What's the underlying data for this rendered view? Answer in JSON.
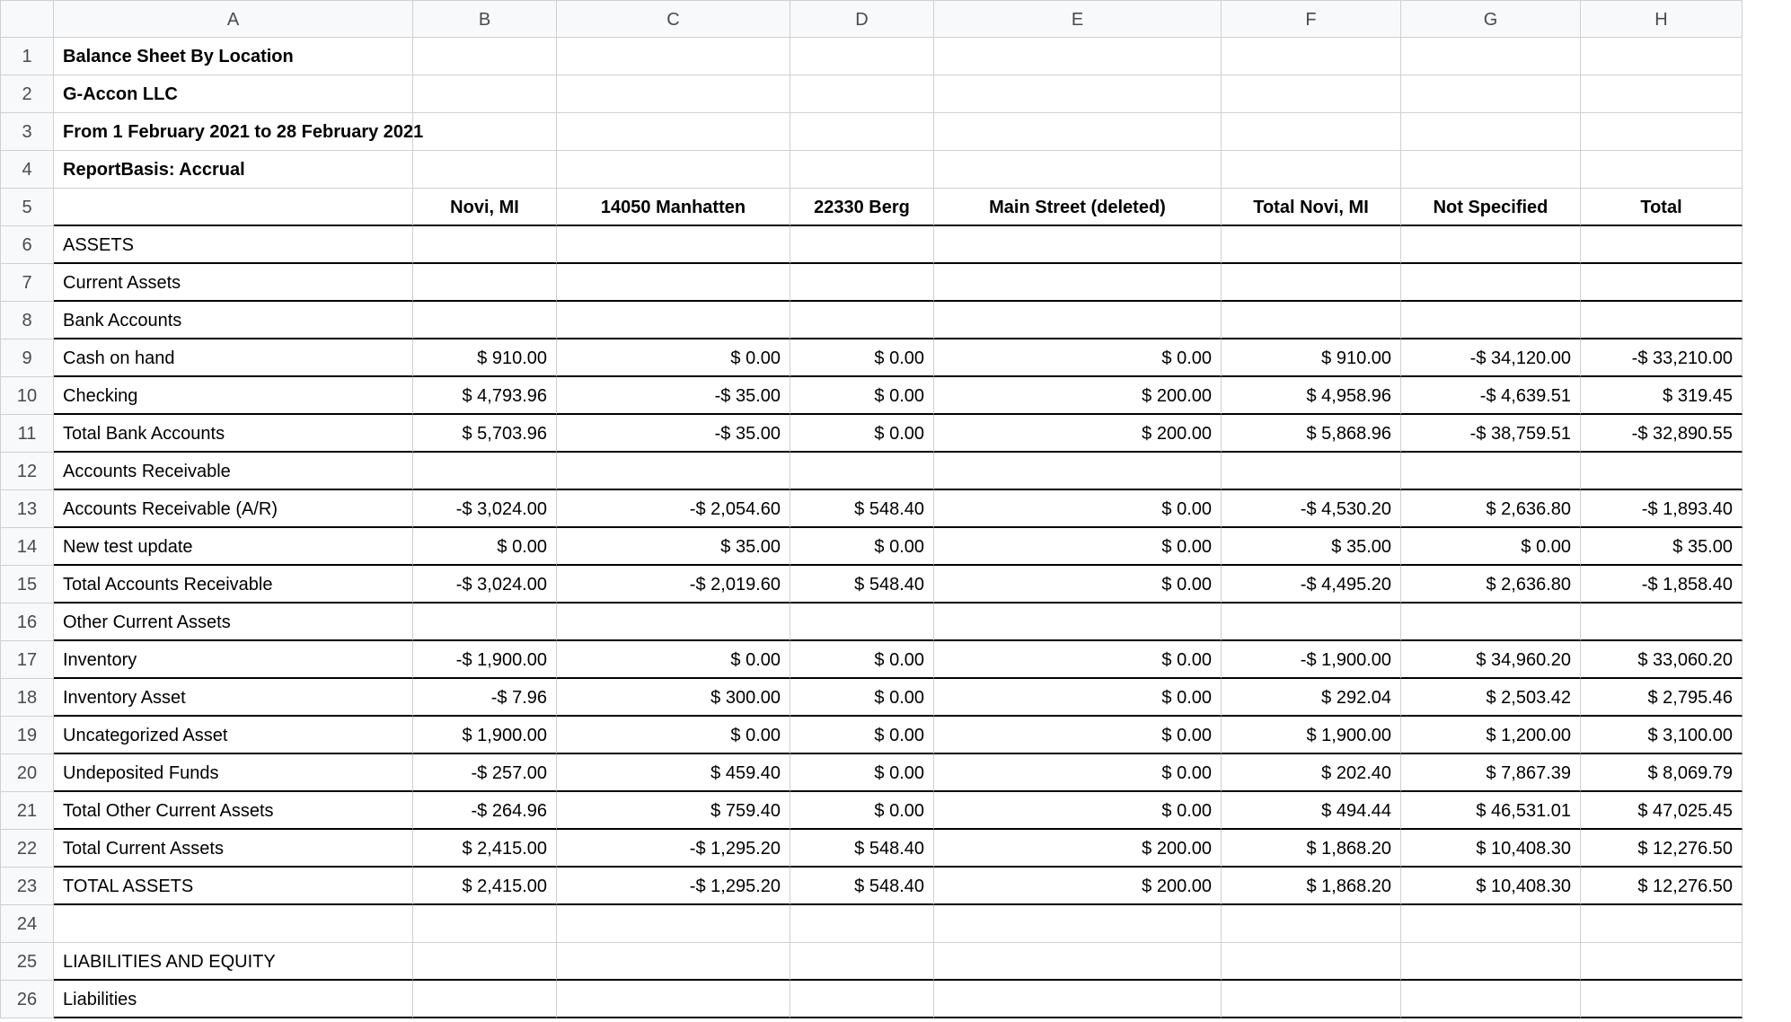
{
  "columns": [
    "A",
    "B",
    "C",
    "D",
    "E",
    "F",
    "G",
    "H"
  ],
  "header": {
    "title": "Balance Sheet By Location",
    "company": "G-Accon LLC",
    "period": "From 1 February 2021 to 28 February 2021",
    "basis": "ReportBasis: Accrual"
  },
  "locHeaders": [
    "Novi, MI",
    "14050 Manhatten",
    "22330 Berg",
    "Main Street (deleted)",
    "Total Novi, MI",
    "Not Specified",
    "Total"
  ],
  "rows": [
    {
      "n": 1,
      "type": "title",
      "a": "title"
    },
    {
      "n": 2,
      "type": "title",
      "a": "company"
    },
    {
      "n": 3,
      "type": "title",
      "a": "period"
    },
    {
      "n": 4,
      "type": "title",
      "a": "basis"
    },
    {
      "n": 5,
      "type": "colhead"
    },
    {
      "n": 6,
      "type": "section",
      "label": "ASSETS"
    },
    {
      "n": 7,
      "type": "section",
      "label": "Current Assets"
    },
    {
      "n": 8,
      "type": "section",
      "label": "Bank Accounts"
    },
    {
      "n": 9,
      "type": "data",
      "label": "Cash on hand",
      "vals": [
        "$ 910.00",
        "$ 0.00",
        "$ 0.00",
        "$ 0.00",
        "$ 910.00",
        "-$ 34,120.00",
        "-$ 33,210.00"
      ]
    },
    {
      "n": 10,
      "type": "data",
      "label": "Checking",
      "vals": [
        "$ 4,793.96",
        "-$ 35.00",
        "$ 0.00",
        "$ 200.00",
        "$ 4,958.96",
        "-$ 4,639.51",
        "$ 319.45"
      ]
    },
    {
      "n": 11,
      "type": "data",
      "label": "Total Bank Accounts",
      "vals": [
        "$ 5,703.96",
        "-$ 35.00",
        "$ 0.00",
        "$ 200.00",
        "$ 5,868.96",
        "-$ 38,759.51",
        "-$ 32,890.55"
      ]
    },
    {
      "n": 12,
      "type": "section",
      "label": "Accounts Receivable"
    },
    {
      "n": 13,
      "type": "data",
      "label": "Accounts Receivable (A/R)",
      "vals": [
        "-$ 3,024.00",
        "-$ 2,054.60",
        "$ 548.40",
        "$ 0.00",
        "-$ 4,530.20",
        "$ 2,636.80",
        "-$ 1,893.40"
      ]
    },
    {
      "n": 14,
      "type": "data",
      "label": "New test update",
      "vals": [
        "$ 0.00",
        "$ 35.00",
        "$ 0.00",
        "$ 0.00",
        "$ 35.00",
        "$ 0.00",
        "$ 35.00"
      ]
    },
    {
      "n": 15,
      "type": "data",
      "label": "Total Accounts Receivable",
      "vals": [
        "-$ 3,024.00",
        "-$ 2,019.60",
        "$ 548.40",
        "$ 0.00",
        "-$ 4,495.20",
        "$ 2,636.80",
        "-$ 1,858.40"
      ]
    },
    {
      "n": 16,
      "type": "section",
      "label": "Other Current Assets"
    },
    {
      "n": 17,
      "type": "data",
      "label": "Inventory",
      "vals": [
        "-$ 1,900.00",
        "$ 0.00",
        "$ 0.00",
        "$ 0.00",
        "-$ 1,900.00",
        "$ 34,960.20",
        "$ 33,060.20"
      ]
    },
    {
      "n": 18,
      "type": "data",
      "label": "Inventory Asset",
      "vals": [
        "-$ 7.96",
        "$ 300.00",
        "$ 0.00",
        "$ 0.00",
        "$ 292.04",
        "$ 2,503.42",
        "$ 2,795.46"
      ]
    },
    {
      "n": 19,
      "type": "data",
      "label": "Uncategorized Asset",
      "vals": [
        "$ 1,900.00",
        "$ 0.00",
        "$ 0.00",
        "$ 0.00",
        "$ 1,900.00",
        "$ 1,200.00",
        "$ 3,100.00"
      ]
    },
    {
      "n": 20,
      "type": "data",
      "label": "Undeposited Funds",
      "vals": [
        "-$ 257.00",
        "$ 459.40",
        "$ 0.00",
        "$ 0.00",
        "$ 202.40",
        "$ 7,867.39",
        "$ 8,069.79"
      ]
    },
    {
      "n": 21,
      "type": "data",
      "label": "Total Other Current Assets",
      "vals": [
        "-$ 264.96",
        "$ 759.40",
        "$ 0.00",
        "$ 0.00",
        "$ 494.44",
        "$ 46,531.01",
        "$ 47,025.45"
      ]
    },
    {
      "n": 22,
      "type": "data",
      "label": "Total Current Assets",
      "vals": [
        "$ 2,415.00",
        "-$ 1,295.20",
        "$ 548.40",
        "$ 200.00",
        "$ 1,868.20",
        "$ 10,408.30",
        "$ 12,276.50"
      ]
    },
    {
      "n": 23,
      "type": "data",
      "label": "TOTAL ASSETS",
      "vals": [
        "$ 2,415.00",
        "-$ 1,295.20",
        "$ 548.40",
        "$ 200.00",
        "$ 1,868.20",
        "$ 10,408.30",
        "$ 12,276.50"
      ]
    },
    {
      "n": 24,
      "type": "blank"
    },
    {
      "n": 25,
      "type": "section",
      "label": "LIABILITIES AND EQUITY"
    },
    {
      "n": 26,
      "type": "section",
      "label": "Liabilities"
    }
  ]
}
